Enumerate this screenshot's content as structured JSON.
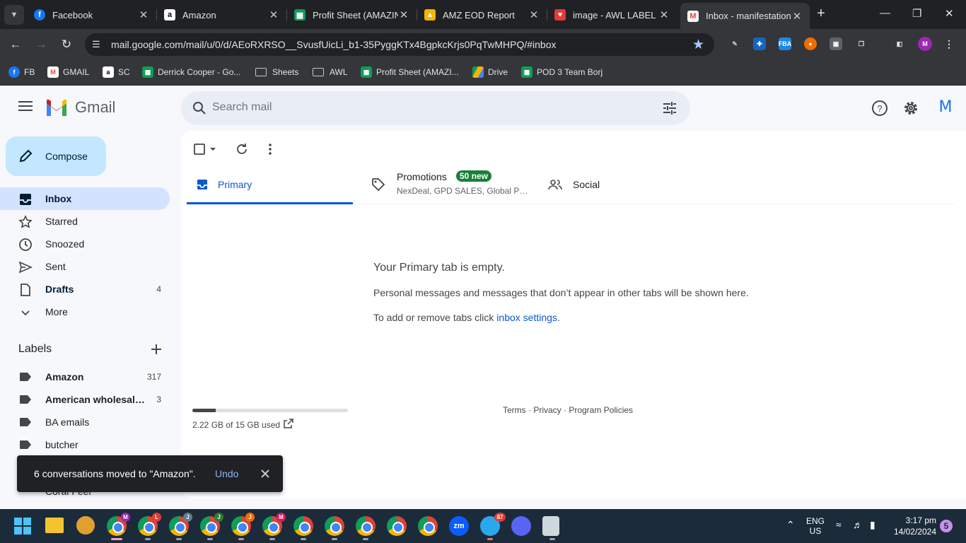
{
  "browser": {
    "tabs": [
      {
        "title": "Facebook",
        "icon": "facebook-icon",
        "color": "#1877f2"
      },
      {
        "title": "Amazon",
        "icon": "amazon-icon",
        "color": "#000000"
      },
      {
        "title": "Profit Sheet (AMAZIN",
        "icon": "sheets-icon",
        "color": "#0f9d58"
      },
      {
        "title": "AMZ EOD Report",
        "icon": "eod-icon",
        "color": "#f4b400"
      },
      {
        "title": "image - AWL LABEL",
        "icon": "awl-icon",
        "color": "#e53935"
      },
      {
        "title": "Inbox - manifestation",
        "icon": "gmail-icon",
        "color": "#ea4335"
      }
    ],
    "url": "mail.google.com/mail/u/0/d/AEoRXRSO__SvusfUicLi_b1-35PyggKTx4BgpkcKrjs0PqTwMHPQ/#inbox",
    "bookmarks": [
      {
        "label": "FB",
        "icon": "facebook-icon"
      },
      {
        "label": "GMAIL",
        "icon": "gmail-icon"
      },
      {
        "label": "SC",
        "icon": "amazon-icon"
      },
      {
        "label": "Derrick Cooper - Go...",
        "icon": "sheets-icon"
      },
      {
        "label": "Sheets",
        "icon": "folder-icon"
      },
      {
        "label": "AWL",
        "icon": "folder-icon"
      },
      {
        "label": "Profit Sheet (AMAZI...",
        "icon": "sheets-icon"
      },
      {
        "label": "Drive",
        "icon": "drive-icon"
      },
      {
        "label": "POD 3 Team Borj",
        "icon": "sheets-icon"
      }
    ],
    "profile_initial": "M",
    "fba_ext": "FBA"
  },
  "gmail": {
    "app_name": "Gmail",
    "search_placeholder": "Search mail",
    "account_initial": "M",
    "compose_label": "Compose",
    "nav": [
      {
        "label": "Inbox",
        "count": "",
        "icon": "inbox-icon"
      },
      {
        "label": "Starred",
        "count": "",
        "icon": "star-icon"
      },
      {
        "label": "Snoozed",
        "count": "",
        "icon": "clock-icon"
      },
      {
        "label": "Sent",
        "count": "",
        "icon": "send-icon"
      },
      {
        "label": "Drafts",
        "count": "4",
        "icon": "draft-icon"
      },
      {
        "label": "More",
        "count": "",
        "icon": "chevron-down-icon"
      }
    ],
    "labels_title": "Labels",
    "labels": [
      {
        "label": "Amazon",
        "count": "317"
      },
      {
        "label": "American wholesale...",
        "count": "3"
      },
      {
        "label": "BA emails",
        "count": ""
      },
      {
        "label": "butcher",
        "count": ""
      }
    ],
    "hidden_label_partial": "Coral Feel",
    "tabs": {
      "primary": "Primary",
      "promotions": "Promotions",
      "promotions_badge": "50 new",
      "promotions_senders": "NexDeal, GPD SALES, Global Pri...",
      "social": "Social"
    },
    "empty": {
      "title": "Your Primary tab is empty.",
      "description": "Personal messages and messages that don’t appear in other tabs will be shown here.",
      "settings_prefix": "To add or remove tabs click ",
      "settings_link": "inbox settings",
      "settings_suffix": "."
    },
    "storage": {
      "text": "2.22 GB of 15 GB used",
      "fraction": 0.148
    },
    "footer": "Terms · Privacy · Program Policies",
    "toast": {
      "message": "6 conversations moved to \"Amazon\".",
      "action": "Undo"
    }
  },
  "taskbar": {
    "profiles": [
      "M",
      "L",
      "J",
      "J",
      "J",
      "M"
    ],
    "telegram_badge": "87",
    "zoom_label": "zm",
    "lang": "ENG",
    "region": "US",
    "time": "3:17 pm",
    "date": "14/02/2024",
    "notifications": "5"
  },
  "colors": {
    "accent": "#0b57d0",
    "compose_bg": "#c2e7ff",
    "active_nav": "#d3e3fd",
    "badge_green": "#188038"
  }
}
